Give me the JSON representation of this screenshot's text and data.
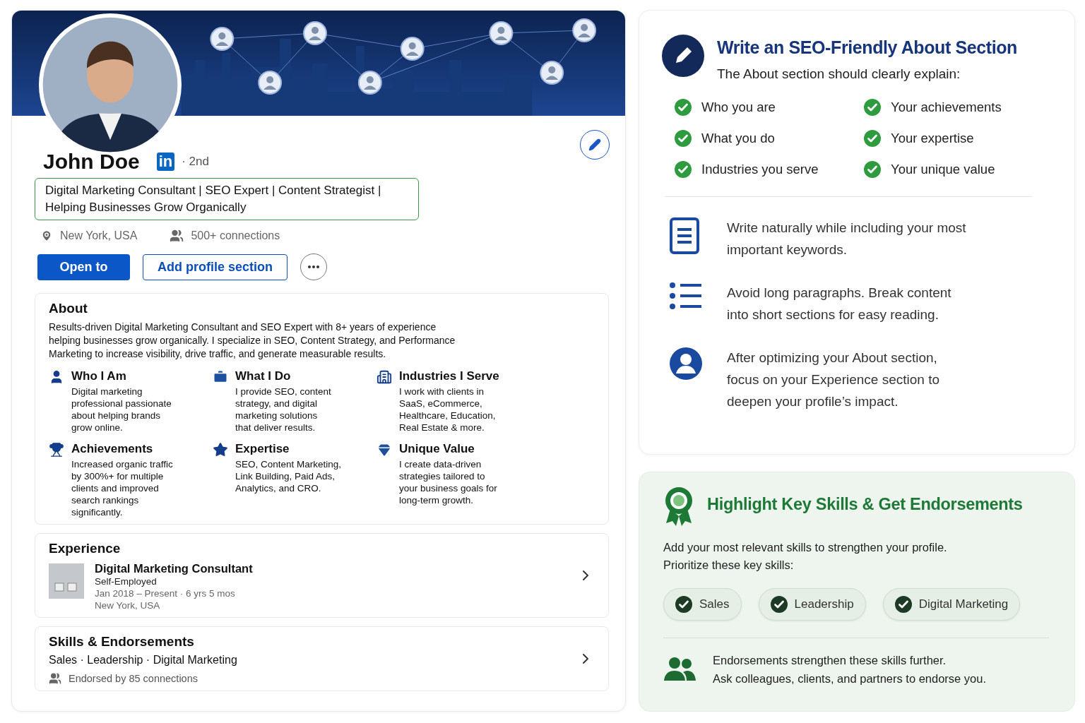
{
  "profile": {
    "name": "John Doe",
    "logo_text": "in",
    "degree": "· 2nd",
    "headline_lines": [
      "Digital Marketing Consultant | SEO Expert | Content Strategist |",
      "Helping Businesses Grow Organically"
    ],
    "location": "New York, USA",
    "connections": "500+ connections",
    "buttons": [
      {
        "label": "Open to",
        "kind": "primary"
      },
      {
        "label": "Add profile section",
        "kind": "outline"
      }
    ]
  },
  "about": {
    "title": "About",
    "summary_lines": [
      "Results-driven Digital Marketing Consultant and SEO Expert with 8+ years of experience",
      "helping businesses grow organically. I specialize in SEO, Content Strategy, and Performance",
      "Marketing to increase visibility, drive traffic, and generate measurable results."
    ],
    "features": [
      {
        "kind": "person",
        "title": "Who I Am",
        "lines": [
          "Digital marketing",
          "professional passionate",
          "about helping brands",
          "grow online."
        ]
      },
      {
        "kind": "briefcase",
        "title": "What I Do",
        "lines": [
          "I provide SEO, content",
          "strategy, and digital",
          "marketing solutions",
          "that deliver results."
        ]
      },
      {
        "kind": "building",
        "title": "Industries I Serve",
        "lines": [
          "I work with clients in",
          "SaaS, eCommerce,",
          "Healthcare, Education,",
          "Real Estate & more."
        ]
      },
      {
        "kind": "trophy",
        "title": "Achievements",
        "lines": [
          "Increased organic traffic",
          "by 300%+ for multiple",
          "clients and improved",
          "search rankings",
          "significantly."
        ]
      },
      {
        "kind": "star",
        "title": "Expertise",
        "lines": [
          "SEO, Content Marketing,",
          "Link Building, Paid Ads,",
          "Analytics, and CRO."
        ]
      },
      {
        "kind": "gem",
        "title": "Unique Value",
        "lines": [
          "I create data-driven",
          "strategies tailored to",
          "your business goals for",
          "long-term growth."
        ]
      }
    ]
  },
  "experience": {
    "title": "Experience",
    "role": "Digital Marketing Consultant",
    "company": "Self-Employed",
    "dates": "Jan 2018 – Present · 6 yrs 5 mos",
    "location": "New York, USA"
  },
  "skills": {
    "title": "Skills & Endorsements",
    "list": "Sales · Leadership · Digital Marketing",
    "endorsed": "Endorsed by 85 connections"
  },
  "about_tips": {
    "title": "Write an SEO-Friendly About Section",
    "subtitle": "The About section should clearly explain:",
    "checklist": [
      "Who you are",
      "Your achievements",
      "What you do",
      "Your expertise",
      "Industries you serve",
      "Your unique value"
    ],
    "tips": [
      {
        "kind": "document",
        "lines": [
          "Write naturally while including your most",
          "important keywords."
        ]
      },
      {
        "kind": "list",
        "lines": [
          "Avoid long paragraphs. Break content",
          "into short sections for easy reading."
        ]
      },
      {
        "kind": "user",
        "lines": [
          "After optimizing your About section,",
          "focus on your Experience section to",
          "deepen your profile’s impact."
        ]
      }
    ]
  },
  "skills_tips": {
    "title": "Highlight Key Skills & Get Endorsements",
    "intro_lines": [
      "Add your most relevant skills to strengthen your profile.",
      "Prioritize these key skills:"
    ],
    "pills": [
      "Sales",
      "Leadership",
      "Digital Marketing"
    ],
    "endorse_lines": [
      "Endorsements strengthen these skills further.",
      "Ask colleagues, clients, and partners to endorse you."
    ]
  }
}
